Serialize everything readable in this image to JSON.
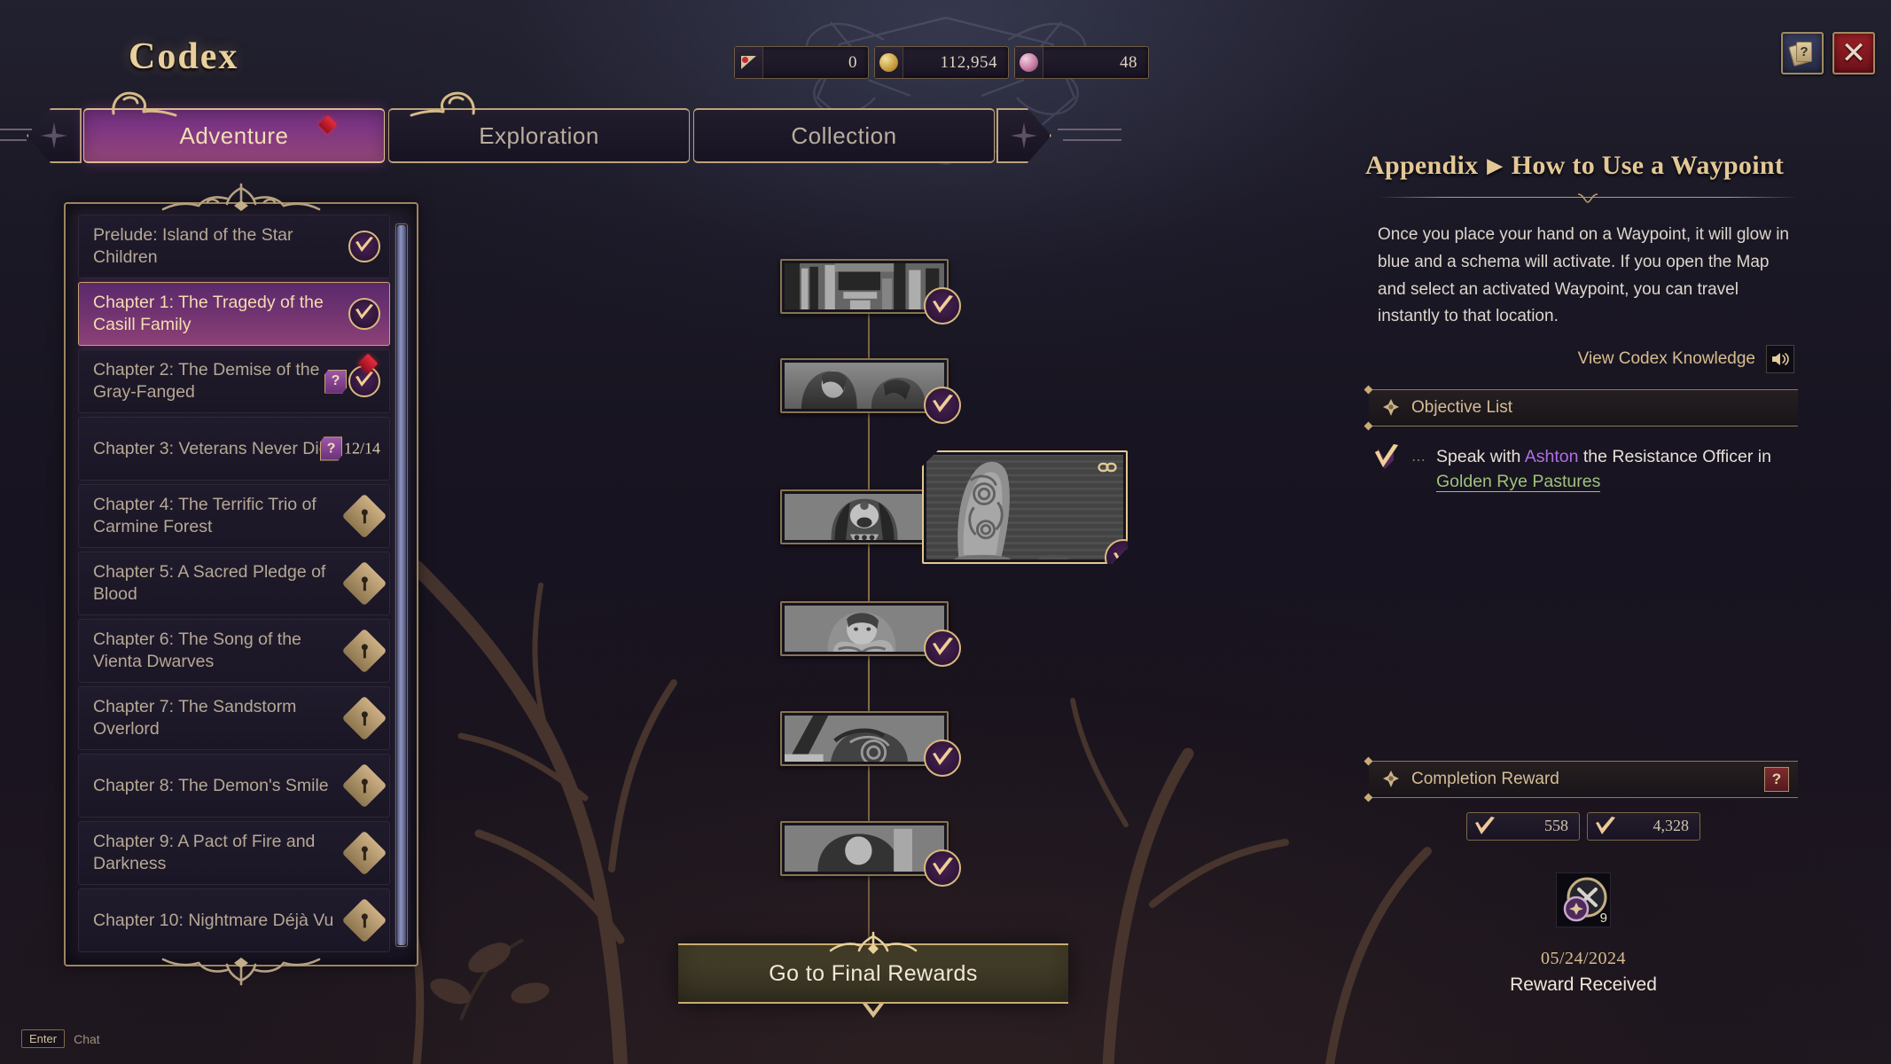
{
  "window": {
    "title": "Codex",
    "help_button": "?",
    "close_button": "✕",
    "help_icon": "help-card-icon",
    "close_icon": "close-x-icon"
  },
  "currencies": [
    {
      "icon": "pennant-icon",
      "value": "0"
    },
    {
      "icon": "gold-coin-icon",
      "value": "112,954"
    },
    {
      "icon": "pink-gem-icon",
      "value": "48"
    }
  ],
  "tabs": {
    "left_cap_icon": "four-point-star-icon",
    "right_cap_icon": "four-point-star-icon",
    "items": [
      {
        "label": "Adventure",
        "active": true,
        "badge": "new-diamond-badge"
      },
      {
        "label": "Exploration",
        "active": false
      },
      {
        "label": "Collection",
        "active": false
      }
    ]
  },
  "chapters": [
    {
      "title": "Prelude: Island of the Star Children",
      "state": "complete",
      "selected": false
    },
    {
      "title": "Chapter 1: The Tragedy of the Casill Family",
      "state": "complete",
      "selected": true
    },
    {
      "title": "Chapter 2: The Demise of the Gray-Fanged",
      "state": "complete",
      "selected": false,
      "question_badge": "?",
      "new_badge": true
    },
    {
      "title": "Chapter 3: Veterans Never Die",
      "state": "progress",
      "selected": false,
      "question_badge": "?",
      "progress": "12/14"
    },
    {
      "title": "Chapter 4: The Terrific Trio of Carmine Forest",
      "state": "locked",
      "selected": false
    },
    {
      "title": "Chapter 5: A Sacred Pledge of Blood",
      "state": "locked",
      "selected": false
    },
    {
      "title": "Chapter 6: The Song of the Vienta Dwarves",
      "state": "locked",
      "selected": false
    },
    {
      "title": "Chapter 7: The Sandstorm Overlord",
      "state": "locked",
      "selected": false
    },
    {
      "title": "Chapter 8: The Demon's Smile",
      "state": "locked",
      "selected": false
    },
    {
      "title": "Chapter 9: A Pact of Fire and Darkness",
      "state": "locked",
      "selected": false
    },
    {
      "title": "Chapter 10: Nightmare Déjà Vu",
      "state": "locked",
      "selected": false
    }
  ],
  "quest_tree": {
    "nodes": [
      {
        "name": "quest-node-1",
        "state": "complete",
        "expanded": false
      },
      {
        "name": "quest-node-2",
        "state": "complete",
        "expanded": false
      },
      {
        "name": "quest-node-3",
        "state": "complete",
        "expanded": false
      },
      {
        "name": "quest-node-3-detail",
        "state": "complete",
        "expanded": true,
        "link_icon": "chain-link-icon"
      },
      {
        "name": "quest-node-4",
        "state": "complete",
        "expanded": false
      },
      {
        "name": "quest-node-5",
        "state": "complete",
        "expanded": false
      },
      {
        "name": "quest-node-6",
        "state": "complete",
        "expanded": false
      }
    ]
  },
  "final_rewards_button": "Go to Final Rewards",
  "appendix": {
    "prefix": "Appendix",
    "separator": "▶",
    "topic": "How to Use a Waypoint",
    "body": "Once you place your hand on a Waypoint, it will glow in blue and a schema will activate. If you open the Map and select an activated Waypoint, you can travel instantly to that location.",
    "codex_knowledge_label": "View Codex Knowledge",
    "speaker_icon": "speaker-icon"
  },
  "objective_section": {
    "heading": "Objective List",
    "heading_icon": "fleur-icon",
    "objective_prefix": "Speak with ",
    "objective_npc": "Ashton",
    "objective_middle": " the Resistance Officer in ",
    "objective_place": "Golden Rye Pastures",
    "check_icon": "objective-check-icon"
  },
  "completion_reward": {
    "heading": "Completion Reward",
    "heading_icon": "fleur-icon",
    "help_badge": "?",
    "rewards": [
      {
        "icon": "roster-xp-icon",
        "value": "558"
      },
      {
        "icon": "silver-xp-icon",
        "value": "4,328"
      }
    ],
    "item": {
      "icon": "card-pack-icon",
      "quantity": "9"
    },
    "date": "05/24/2024",
    "status": "Reward Received"
  },
  "chat_hint": {
    "key": "Enter",
    "label": "Chat"
  },
  "colors": {
    "gold": "#d8b97f",
    "panel_border": "#9b8560",
    "active_tab": "#8a3f7d",
    "npc_purple": "#b06fe6",
    "place_green": "#9fc27c",
    "close_red": "#9b2027",
    "alert_red": "#e52b3c"
  }
}
